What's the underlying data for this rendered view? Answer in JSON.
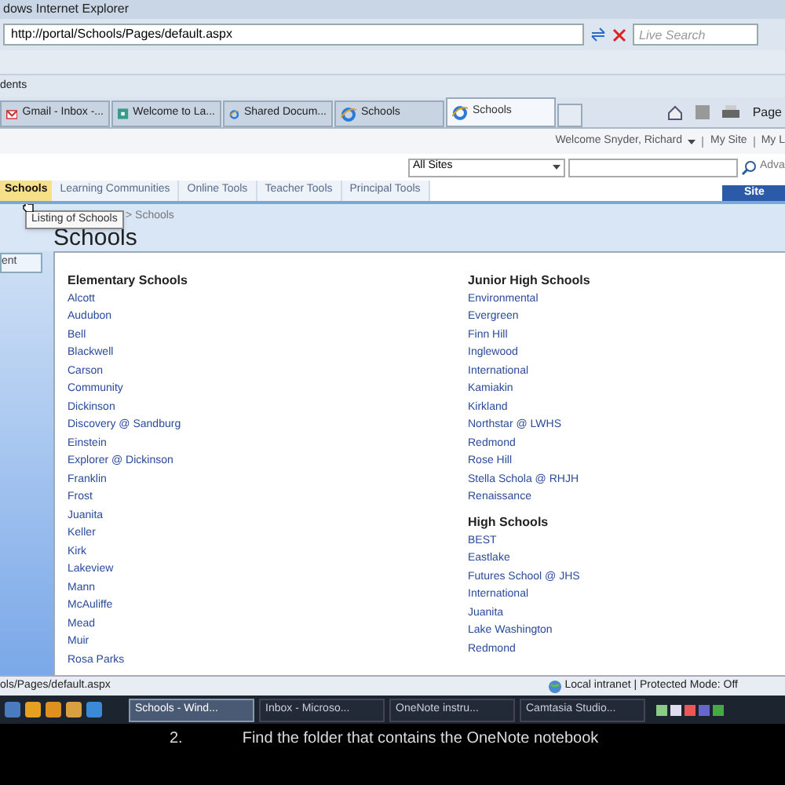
{
  "window": {
    "title": "dows Internet Explorer"
  },
  "address_bar": {
    "url": "http://portal/Schools/Pages/default.aspx",
    "search_placeholder": "Live Search"
  },
  "favorites_bar": {
    "label": "dents"
  },
  "browser_tabs": [
    {
      "label": "Gmail - Inbox -...",
      "kind": "mail",
      "selected": false
    },
    {
      "label": "Welcome to La...",
      "kind": "site",
      "selected": false
    },
    {
      "label": "Shared Docum...",
      "kind": "ie",
      "selected": false
    },
    {
      "label": "Schools",
      "kind": "ie",
      "selected": false
    },
    {
      "label": "Schools",
      "kind": "ie",
      "selected": true
    }
  ],
  "command_bar": {
    "page_label": "Page"
  },
  "user_bar": {
    "welcome": "Welcome Snyder, Richard",
    "links": [
      "My Site",
      "My L"
    ]
  },
  "site_search": {
    "scope": "All Sites",
    "advanced": "Adva",
    "site_actions": "Site"
  },
  "nav_tabs": [
    {
      "label": "Schools",
      "selected": true
    },
    {
      "label": "Learning Communities",
      "selected": false
    },
    {
      "label": "Online Tools",
      "selected": false
    },
    {
      "label": "Teacher Tools",
      "selected": false
    },
    {
      "label": "Principal Tools",
      "selected": false
    }
  ],
  "tooltip": "Listing of Schools",
  "breadcrumb": "> Schools",
  "page_title": "Schools",
  "sidebar_button": "ent",
  "columns": [
    {
      "sections": [
        {
          "heading": "Elementary Schools",
          "items": [
            "Alcott",
            "Audubon",
            "Bell",
            "Blackwell",
            "Carson",
            "Community",
            "Dickinson",
            "Discovery @ Sandburg",
            "Einstein",
            "Explorer @ Dickinson",
            "Franklin",
            "Frost",
            "Juanita",
            "Keller",
            "Kirk",
            "Lakeview",
            "Mann",
            "McAuliffe",
            "Mead",
            "Muir",
            "Rosa Parks"
          ]
        }
      ]
    },
    {
      "sections": [
        {
          "heading": "Junior High Schools",
          "items": [
            "Environmental",
            "Evergreen",
            "Finn Hill",
            "Inglewood",
            "International",
            "Kamiakin",
            "Kirkland",
            "Northstar @ LWHS",
            "Redmond",
            "Rose Hill",
            "Stella Schola @ RHJH",
            "Renaissance"
          ]
        },
        {
          "heading": "High Schools",
          "items": [
            "BEST",
            "Eastlake",
            "Futures School @ JHS",
            "International",
            "Juanita",
            "Lake Washington",
            "Redmond"
          ]
        }
      ]
    }
  ],
  "status_bar": {
    "url": "ols/Pages/default.aspx",
    "zone": "Local intranet | Protected Mode: Off"
  },
  "taskbar": [
    {
      "label": "Schools - Wind...",
      "selected": true
    },
    {
      "label": "Inbox - Microso...",
      "selected": false
    },
    {
      "label": "OneNote instru...",
      "selected": false
    },
    {
      "label": "Camtasia Studio...",
      "selected": false
    }
  ],
  "caption": {
    "number": "2.",
    "text": "Find the folder that contains the OneNote notebook"
  }
}
